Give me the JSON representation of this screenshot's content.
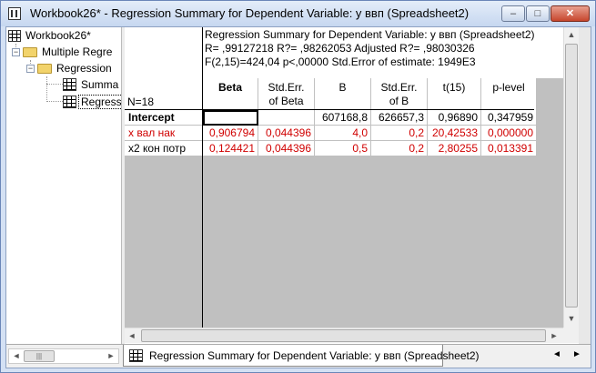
{
  "window": {
    "title": "Workbook26* - Regression Summary for Dependent Variable: y ввп (Spreadsheet2)",
    "buttons": {
      "minimize": "‒",
      "maximize": "□",
      "close": "✕"
    }
  },
  "tree": {
    "items": [
      {
        "label": "Workbook26*"
      },
      {
        "label": "Multiple Regre"
      },
      {
        "label": "Regression"
      },
      {
        "label": "Summa"
      },
      {
        "label": "Regress"
      }
    ]
  },
  "sheet": {
    "title_lines": [
      "Regression Summary for Dependent Variable: y ввп (Spreadsheet2)",
      "R= ,99127218 R?= ,98262053 Adjusted R?= ,98030326",
      "F(2,15)=424,04 p<,00000 Std.Error of estimate: 1949E3"
    ],
    "n_label": "N=18",
    "columns": [
      {
        "line1": "Beta",
        "line2": ""
      },
      {
        "line1": "Std.Err.",
        "line2": "of Beta"
      },
      {
        "line1": "B",
        "line2": ""
      },
      {
        "line1": "Std.Err.",
        "line2": "of B"
      },
      {
        "line1": "t(15)",
        "line2": ""
      },
      {
        "line1": "p-level",
        "line2": ""
      }
    ],
    "rows": [
      {
        "label": "Intercept",
        "cells": [
          "",
          "",
          "607168,8",
          "626657,3",
          "0,96890",
          "0,347959"
        ]
      },
      {
        "label": "x вал нак",
        "cells": [
          "0,906794",
          "0,044396",
          "4,0",
          "0,2",
          "20,42533",
          "0,000000"
        ]
      },
      {
        "label": "x2 кон потр",
        "cells": [
          "0,124421",
          "0,044396",
          "0,5",
          "0,2",
          "2,80255",
          "0,013391"
        ]
      }
    ],
    "highlight_color": "#d00000"
  },
  "tab": {
    "label": "Regression Summary for Dependent Variable: y ввп (Spreadsheet2)"
  },
  "scroll": {
    "left": "◄",
    "right": "►",
    "up": "▲",
    "down": "▼",
    "grip": "|||"
  }
}
